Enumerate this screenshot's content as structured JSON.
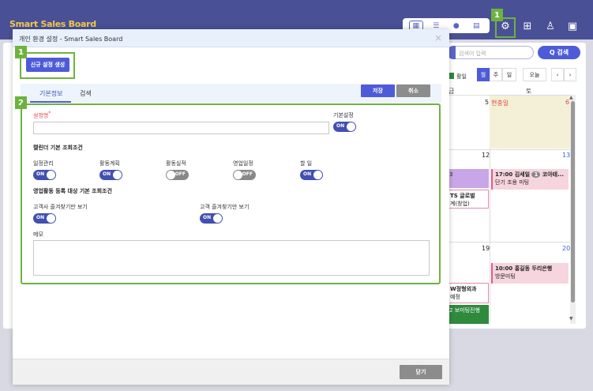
{
  "app": {
    "title": "Smart Sales Board"
  },
  "header": {
    "badge_settings": "1"
  },
  "search": {
    "placeholder": "검색어 입력",
    "button_label": "Q 검색"
  },
  "calendar": {
    "legend_label": "활일",
    "view_buttons": [
      "월",
      "주",
      "일"
    ],
    "today_label": "오늘",
    "prev": "‹",
    "next": "›",
    "dow": [
      "금",
      "토"
    ],
    "days": [
      "5",
      "6",
      "12",
      "13",
      "19",
      "20"
    ],
    "holiday": "현충일",
    "events": {
      "e1_count": "3",
      "e2_title": "TS 글로벌",
      "e2_sub": "계(창업)",
      "e3_title": "17:00 김세일",
      "e3_badge": "1",
      "e3_more": "코아테...",
      "e3_sub": "단기 조용 미팅",
      "e4_title": "10:00 홍길동 두리은행",
      "e4_sub": "방문미팅",
      "e5_title": "W정형외과",
      "e5_sub": "예정",
      "e6_count": "2",
      "e6_title": "보미팅진행"
    },
    "colors": {
      "purple": "#c9a6e8",
      "pink": "#f6d5de",
      "green": "#2e8b3c",
      "holiday_red": "#e04848",
      "saturday_blue": "#3a62d8"
    }
  },
  "modal": {
    "title": "개인 환경 설정 - Smart Sales Board",
    "close_icon": "×",
    "badge_new": "1",
    "new_setting_button": "신규 설정 생성",
    "tabs": [
      "기본정보",
      "검색"
    ],
    "save_button": "저장",
    "cancel_button": "취소",
    "badge_form": "2",
    "form": {
      "setting_name_label": "설정명",
      "required_mark": "*",
      "setting_name_value": "",
      "default_setting_label": "기본설정",
      "default_setting_toggle": "ON",
      "calendar_section": "캘린더 기본 조회조건",
      "calendar_toggles": [
        {
          "label": "일정관리",
          "state": "ON"
        },
        {
          "label": "활동계획",
          "state": "ON"
        },
        {
          "label": "활동실적",
          "state": "OFF"
        },
        {
          "label": "영업일정",
          "state": "OFF"
        },
        {
          "label": "할 일",
          "state": "ON"
        }
      ],
      "sales_section": "영업활동 등록 대상 기본 조회조건",
      "sales_toggles": [
        {
          "label": "고객사 즐겨찾기만 보기",
          "state": "ON"
        },
        {
          "label": "고객 즐겨찾기만 보기",
          "state": "ON"
        }
      ],
      "memo_label": "메모",
      "memo_value": ""
    },
    "close_button": "닫기"
  },
  "accent": {
    "primary": "#4e5bd8",
    "highlight": "#6db33f",
    "header": "#4a5095"
  }
}
